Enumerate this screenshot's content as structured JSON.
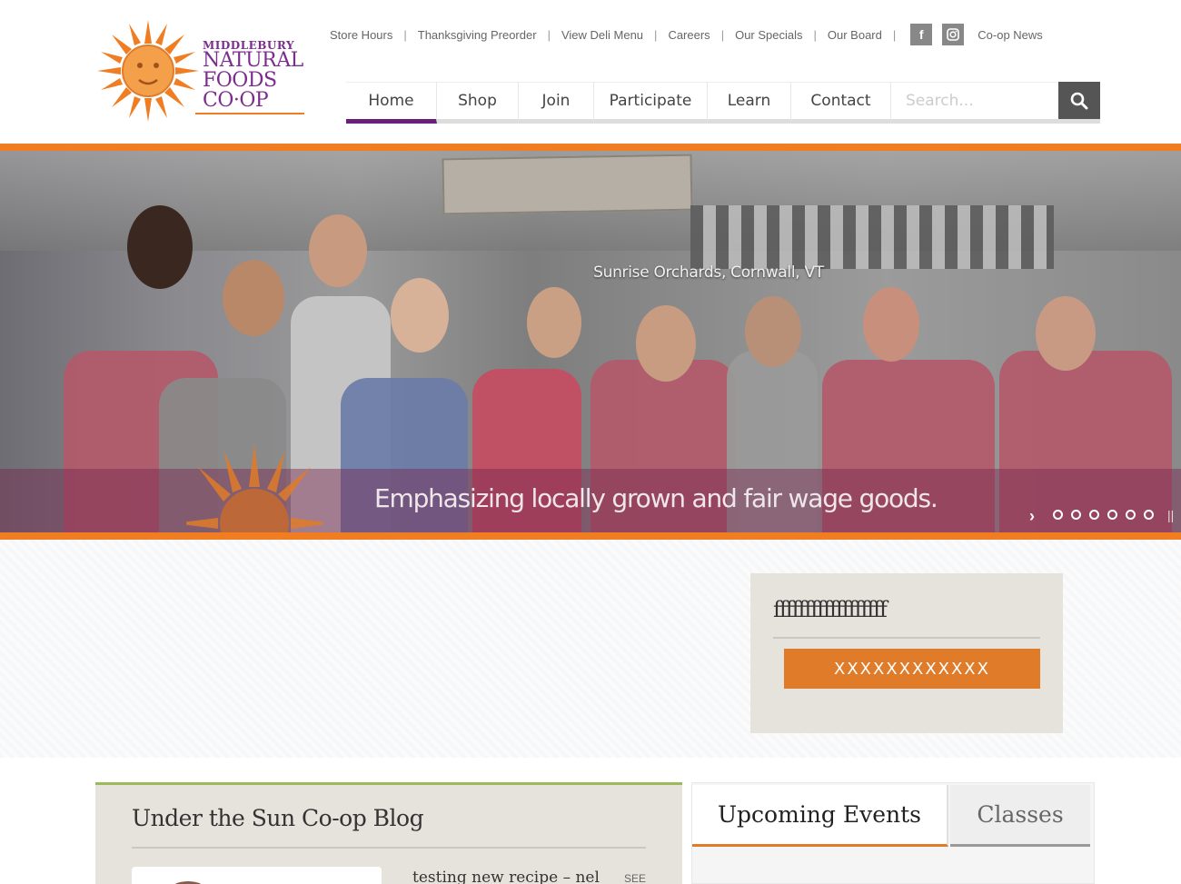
{
  "logo": {
    "line1": "MIDDLEBURY",
    "line2": "NATURAL",
    "line3": "FOODS",
    "line4": "CO·OP"
  },
  "topnav": {
    "items": [
      "Store Hours",
      "Thanksgiving Preorder",
      "View Deli Menu",
      "Careers",
      "Our Specials",
      "Our Board"
    ],
    "news": "Co-op News"
  },
  "mainnav": {
    "items": [
      "Home",
      "Shop",
      "Join",
      "Participate",
      "Learn",
      "Contact"
    ],
    "active": "Home"
  },
  "search": {
    "placeholder": "Search..."
  },
  "hero": {
    "location": "Sunrise Orchards, Cornwall, VT",
    "caption": "Emphasizing locally grown and fair wage goods.",
    "slide_count": 6
  },
  "promo": {
    "title": "ffffffffffffffffff",
    "button": "XXXXXXXXXXXX"
  },
  "blog": {
    "title": "Under the Sun Co-op Blog",
    "post_title": "testing new recipe – nel",
    "see": "SEE"
  },
  "events": {
    "tabs": [
      "Upcoming Events",
      "Classes"
    ]
  },
  "colors": {
    "orange": "#f07d22",
    "purple": "#6b1f7a",
    "green": "#9bbb5b"
  }
}
